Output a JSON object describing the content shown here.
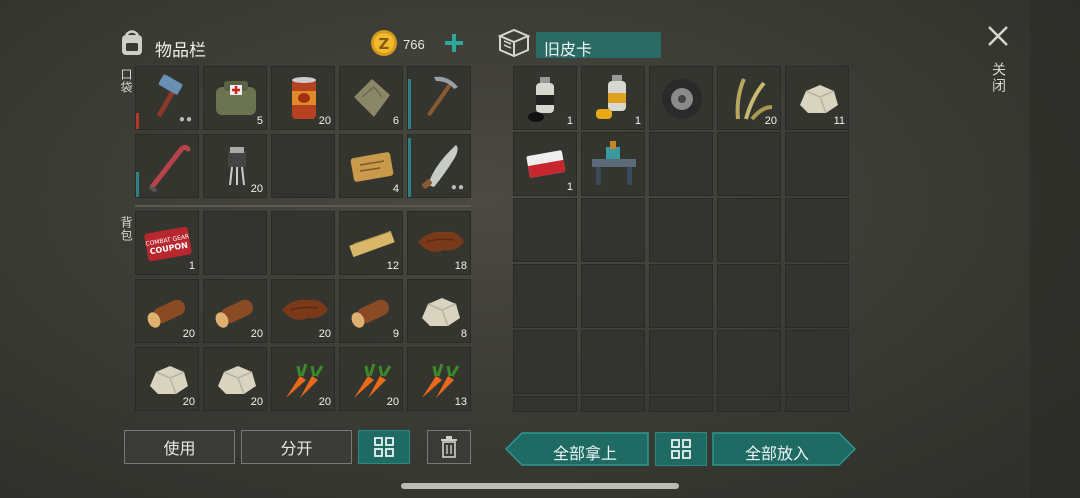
{
  "inventory": {
    "title": "物品栏",
    "coins": "766",
    "pocket_label": "口袋",
    "backpack_label": "背包",
    "pocket": [
      {
        "icon": "hammer-icon",
        "count": "",
        "dots": true,
        "bar": "#b33a2a",
        "bar_level": 0.25
      },
      {
        "icon": "first-aid-bag-icon",
        "count": "5"
      },
      {
        "icon": "canned-food-icon",
        "count": "20"
      },
      {
        "icon": "cloth-icon",
        "count": "6"
      },
      {
        "icon": "pickaxe-icon",
        "count": "",
        "bar": "#2f7f83",
        "bar_level": 0.8
      },
      {
        "icon": "crowbar-icon",
        "count": "",
        "bar": "#2f7f83",
        "bar_level": 0.4
      },
      {
        "icon": "transistor-icon",
        "count": "20"
      },
      {
        "icon": "empty",
        "count": ""
      },
      {
        "icon": "ticket-icon",
        "count": "4"
      },
      {
        "icon": "machete-icon",
        "count": "",
        "dots": true,
        "bar": "#2f7f83",
        "bar_level": 0.95
      }
    ],
    "backpack": [
      {
        "icon": "coupon-icon",
        "count": "1"
      },
      {
        "icon": "empty",
        "count": ""
      },
      {
        "icon": "empty",
        "count": ""
      },
      {
        "icon": "plank-icon",
        "count": "12"
      },
      {
        "icon": "leather-icon",
        "count": "18"
      },
      {
        "icon": "log-icon",
        "count": "20"
      },
      {
        "icon": "log-icon",
        "count": "20"
      },
      {
        "icon": "leather-icon",
        "count": "20"
      },
      {
        "icon": "log-icon",
        "count": "9"
      },
      {
        "icon": "stone-icon",
        "count": "8"
      },
      {
        "icon": "stone-icon",
        "count": "20"
      },
      {
        "icon": "stone-icon",
        "count": "20"
      },
      {
        "icon": "carrot-icon",
        "count": "20"
      },
      {
        "icon": "carrot-icon",
        "count": "20"
      },
      {
        "icon": "carrot-icon",
        "count": "13"
      }
    ],
    "buttons": {
      "use": "使用",
      "split": "分开"
    }
  },
  "container": {
    "title": "旧皮卡",
    "items": [
      {
        "icon": "spray-can-black-icon",
        "count": "1"
      },
      {
        "icon": "spray-can-yellow-icon",
        "count": "1"
      },
      {
        "icon": "tire-icon",
        "count": ""
      },
      {
        "icon": "plant-fiber-icon",
        "count": "20"
      },
      {
        "icon": "stone-icon",
        "count": "11"
      },
      {
        "icon": "cigarettes-icon",
        "count": "1"
      },
      {
        "icon": "workbench-icon",
        "count": ""
      }
    ],
    "buttons": {
      "take_all": "全部拿上",
      "put_all": "全部放入"
    }
  },
  "close": {
    "label": "关闭"
  }
}
